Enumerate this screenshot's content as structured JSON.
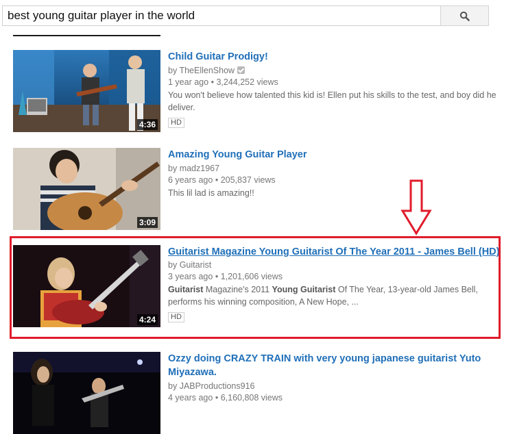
{
  "search": {
    "query": "best young guitar player in the world",
    "button_icon": "search-icon"
  },
  "results": [
    {
      "title": "Child Guitar Prodigy!",
      "channel": "TheEllenShow",
      "verified": true,
      "age": "1 year ago",
      "views": "3,244,252 views",
      "description": "You won't believe how talented this kid is! Ellen put his skills to the test, and boy did he deliver.",
      "duration": "4:36",
      "badge": "HD"
    },
    {
      "title": "Amazing Young Guitar Player",
      "channel": "madz1967",
      "age": "6 years ago",
      "views": "205,837 views",
      "description": "This lil lad is amazing!!",
      "duration": "3:09"
    },
    {
      "title": "Guitarist Magazine Young Guitarist Of The Year 2011 - James Bell (HD)",
      "channel": "Guitarist",
      "age": "3 years ago",
      "views": "1,201,606 views",
      "desc_bold1": "Guitarist",
      "desc_part1": " Magazine's 2011 ",
      "desc_bold2": "Young Guitarist",
      "desc_part2": " Of The Year, 13-year-old James Bell, performs his winning composition, A New Hope, ...",
      "duration": "4:24",
      "badge": "HD"
    },
    {
      "title": "Ozzy doing CRAZY TRAIN with very young japanese guitarist Yuto Miyazawa.",
      "channel": "JABProductions916",
      "age": "4 years ago",
      "views": "6,160,808 views"
    }
  ],
  "labels": {
    "by": "by",
    "dot": "•"
  },
  "colors": {
    "link": "#1f6fb8",
    "highlight": "#e01b2b",
    "meta": "#767676"
  }
}
